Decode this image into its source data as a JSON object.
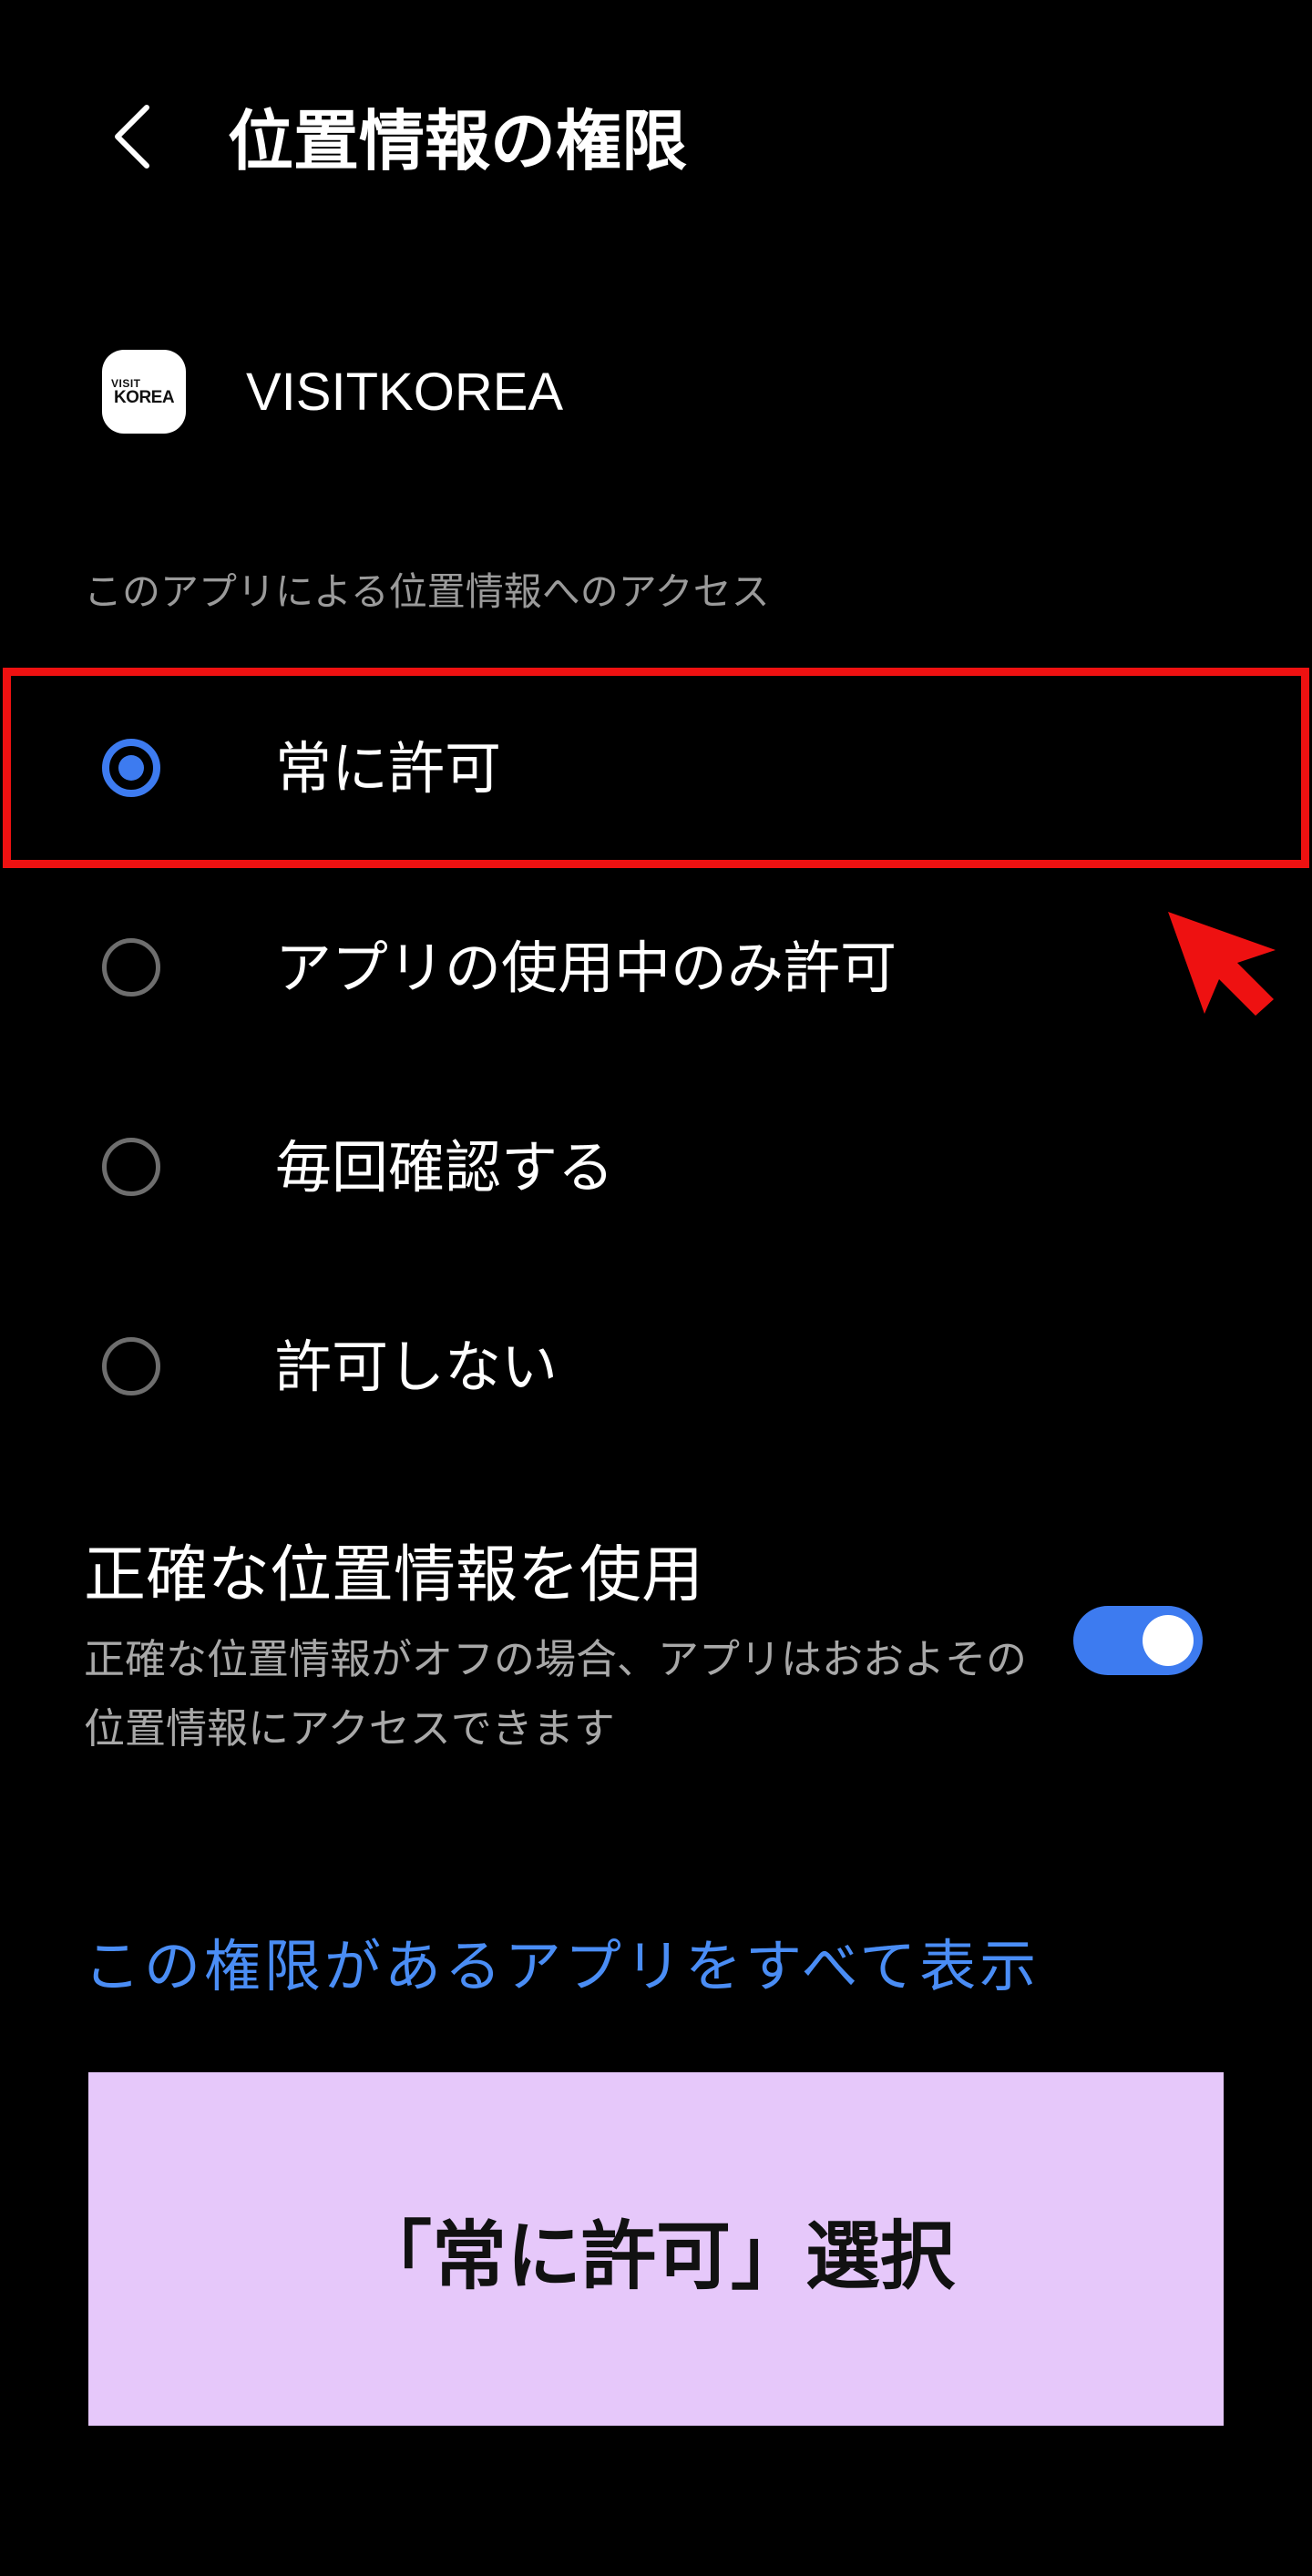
{
  "header": {
    "title": "位置情報の権限",
    "back_icon": "chevron-left-icon"
  },
  "app": {
    "icon_line1": "VISIT",
    "icon_line2": "KOREA",
    "name": "VISITKOREA"
  },
  "section_label": "このアプリによる位置情報へのアクセス",
  "options": [
    {
      "label": "常に許可",
      "selected": true
    },
    {
      "label": "アプリの使用中のみ許可",
      "selected": false
    },
    {
      "label": "毎回確認する",
      "selected": false
    },
    {
      "label": "許可しない",
      "selected": false
    }
  ],
  "precise_location": {
    "title": "正確な位置情報を使用",
    "description": "正確な位置情報がオフの場合、アプリはおおよその位置情報にアクセスできます",
    "enabled": true
  },
  "show_all_link": "この権限があるアプリをすべて表示",
  "caption": "「常に許可」選択",
  "colors": {
    "accent": "#3d7bf0",
    "link": "#4a8df5",
    "highlight": "#ee1111",
    "caption_bg": "#e6c8fa",
    "background": "#000000"
  }
}
